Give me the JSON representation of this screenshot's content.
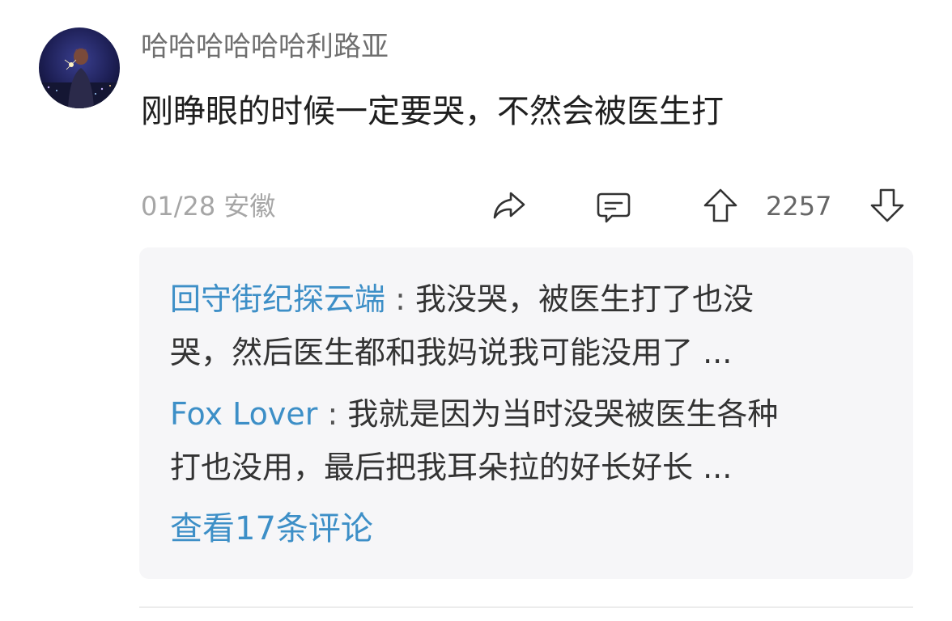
{
  "comment": {
    "username": "哈哈哈哈哈哈利路亚",
    "text": "刚睁眼的时候一定要哭，不然会被医生打",
    "date": "01/28",
    "location": "安徽",
    "vote_count": "2257",
    "avatar_icon": "avatar-night-city-image"
  },
  "actions": {
    "share_icon": "share-icon",
    "reply_icon": "comment-icon",
    "upvote_icon": "arrow-up-icon",
    "downvote_icon": "arrow-down-icon"
  },
  "replies": [
    {
      "author": "回守街纪探云端",
      "separator": " : ",
      "line1": "我没哭，被医生打了也没",
      "line2": "哭，然后医生都和我妈说我可能没用了 ..."
    },
    {
      "author": "Fox Lover",
      "separator": " : ",
      "line1": "我就是因为当时没哭被医生各种",
      "line2": "打也没用，最后把我耳朵拉的好长好长 ..."
    }
  ],
  "view_more": "查看17条评论",
  "colors": {
    "link_blue": "#3d8fc7",
    "panel_bg": "#f6f6f8",
    "meta_gray": "#a6a6a6"
  }
}
